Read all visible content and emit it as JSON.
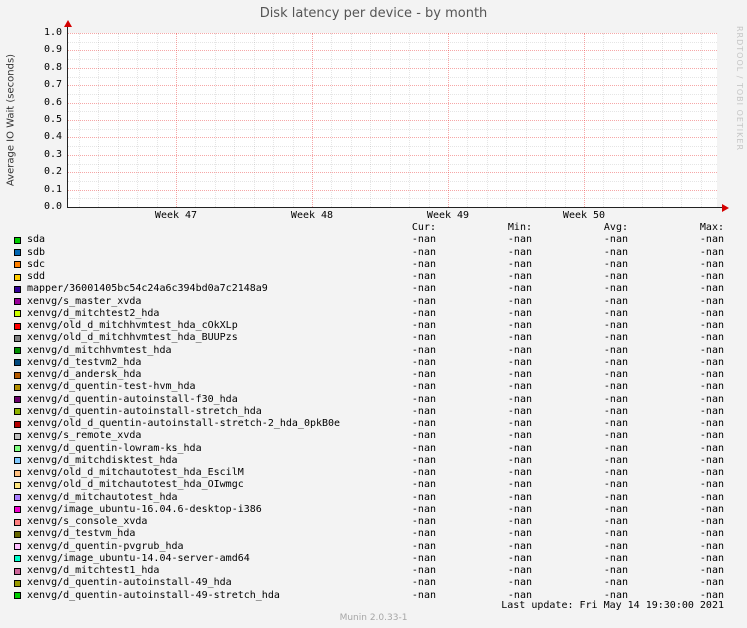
{
  "title": "Disk latency per device - by month",
  "watermark": "RRDTOOL / TOBI OETIKER",
  "y_axis": {
    "label": "Average IO Wait (seconds)"
  },
  "legend": {
    "headers": [
      "Cur:",
      "Min:",
      "Avg:",
      "Max:"
    ]
  },
  "footer": {
    "last_update": "Last update: Fri May 14 19:30:00 2021",
    "version": "Munin 2.0.33-1"
  },
  "chart_data": {
    "type": "line",
    "title": "Disk latency per device - by month",
    "xlabel": "",
    "ylabel": "Average IO Wait (seconds)",
    "ylim": [
      0.0,
      1.0
    ],
    "yticks": [
      0.0,
      0.1,
      0.2,
      0.3,
      0.4,
      0.5,
      0.6,
      0.7,
      0.8,
      0.9,
      1.0
    ],
    "xticklabels": [
      "Week 47",
      "Week 48",
      "Week 49",
      "Week 50"
    ],
    "grid": true,
    "legend_position": "bottom",
    "series": [
      {
        "name": "sda",
        "color": "#00CC00",
        "cur": "-nan",
        "min": "-nan",
        "avg": "-nan",
        "max": "-nan"
      },
      {
        "name": "sdb",
        "color": "#0066B3",
        "cur": "-nan",
        "min": "-nan",
        "avg": "-nan",
        "max": "-nan"
      },
      {
        "name": "sdc",
        "color": "#FF8000",
        "cur": "-nan",
        "min": "-nan",
        "avg": "-nan",
        "max": "-nan"
      },
      {
        "name": "sdd",
        "color": "#FFCC00",
        "cur": "-nan",
        "min": "-nan",
        "avg": "-nan",
        "max": "-nan"
      },
      {
        "name": "mapper/36001405bc54c24a6c394bd0a7c2148a9",
        "color": "#330099",
        "cur": "-nan",
        "min": "-nan",
        "avg": "-nan",
        "max": "-nan"
      },
      {
        "name": "xenvg/s_master_xvda",
        "color": "#990099",
        "cur": "-nan",
        "min": "-nan",
        "avg": "-nan",
        "max": "-nan"
      },
      {
        "name": "xenvg/d_mitchtest2_hda",
        "color": "#CCFF00",
        "cur": "-nan",
        "min": "-nan",
        "avg": "-nan",
        "max": "-nan"
      },
      {
        "name": "xenvg/old_d_mitchhvmtest_hda_cOkXLp",
        "color": "#FF0000",
        "cur": "-nan",
        "min": "-nan",
        "avg": "-nan",
        "max": "-nan"
      },
      {
        "name": "xenvg/old_d_mitchhvmtest_hda_BUUPzs",
        "color": "#808080",
        "cur": "-nan",
        "min": "-nan",
        "avg": "-nan",
        "max": "-nan"
      },
      {
        "name": "xenvg/d_mitchhvmtest_hda",
        "color": "#008F00",
        "cur": "-nan",
        "min": "-nan",
        "avg": "-nan",
        "max": "-nan"
      },
      {
        "name": "xenvg/d_testvm2_hda",
        "color": "#00487D",
        "cur": "-nan",
        "min": "-nan",
        "avg": "-nan",
        "max": "-nan"
      },
      {
        "name": "xenvg/d_andersk_hda",
        "color": "#B35A00",
        "cur": "-nan",
        "min": "-nan",
        "avg": "-nan",
        "max": "-nan"
      },
      {
        "name": "xenvg/d_quentin-test-hvm_hda",
        "color": "#B38F00",
        "cur": "-nan",
        "min": "-nan",
        "avg": "-nan",
        "max": "-nan"
      },
      {
        "name": "xenvg/d_quentin-autoinstall-f30_hda",
        "color": "#6B006B",
        "cur": "-nan",
        "min": "-nan",
        "avg": "-nan",
        "max": "-nan"
      },
      {
        "name": "xenvg/d_quentin-autoinstall-stretch_hda",
        "color": "#8FB300",
        "cur": "-nan",
        "min": "-nan",
        "avg": "-nan",
        "max": "-nan"
      },
      {
        "name": "xenvg/old_d_quentin-autoinstall-stretch-2_hda_0pkB0e",
        "color": "#B30000",
        "cur": "-nan",
        "min": "-nan",
        "avg": "-nan",
        "max": "-nan"
      },
      {
        "name": "xenvg/s_remote_xvda",
        "color": "#BEBEBE",
        "cur": "-nan",
        "min": "-nan",
        "avg": "-nan",
        "max": "-nan"
      },
      {
        "name": "xenvg/d_quentin-lowram-ks_hda",
        "color": "#80FF80",
        "cur": "-nan",
        "min": "-nan",
        "avg": "-nan",
        "max": "-nan"
      },
      {
        "name": "xenvg/d_mitchdisktest_hda",
        "color": "#80C9FF",
        "cur": "-nan",
        "min": "-nan",
        "avg": "-nan",
        "max": "-nan"
      },
      {
        "name": "xenvg/old_d_mitchautotest_hda_EscilM",
        "color": "#FFC080",
        "cur": "-nan",
        "min": "-nan",
        "avg": "-nan",
        "max": "-nan"
      },
      {
        "name": "xenvg/old_d_mitchautotest_hda_OIwmgc",
        "color": "#FFE680",
        "cur": "-nan",
        "min": "-nan",
        "avg": "-nan",
        "max": "-nan"
      },
      {
        "name": "xenvg/d_mitchautotest_hda",
        "color": "#AA80FF",
        "cur": "-nan",
        "min": "-nan",
        "avg": "-nan",
        "max": "-nan"
      },
      {
        "name": "xenvg/image_ubuntu-16.04.6-desktop-i386",
        "color": "#EE00CC",
        "cur": "-nan",
        "min": "-nan",
        "avg": "-nan",
        "max": "-nan"
      },
      {
        "name": "xenvg/s_console_xvda",
        "color": "#FF8080",
        "cur": "-nan",
        "min": "-nan",
        "avg": "-nan",
        "max": "-nan"
      },
      {
        "name": "xenvg/d_testvm_hda",
        "color": "#666600",
        "cur": "-nan",
        "min": "-nan",
        "avg": "-nan",
        "max": "-nan"
      },
      {
        "name": "xenvg/d_quentin-pvgrub_hda",
        "color": "#FFBFFF",
        "cur": "-nan",
        "min": "-nan",
        "avg": "-nan",
        "max": "-nan"
      },
      {
        "name": "xenvg/image_ubuntu-14.04-server-amd64",
        "color": "#00FFCC",
        "cur": "-nan",
        "min": "-nan",
        "avg": "-nan",
        "max": "-nan"
      },
      {
        "name": "xenvg/d_mitchtest1_hda",
        "color": "#CC6699",
        "cur": "-nan",
        "min": "-nan",
        "avg": "-nan",
        "max": "-nan"
      },
      {
        "name": "xenvg/d_quentin-autoinstall-49_hda",
        "color": "#999900",
        "cur": "-nan",
        "min": "-nan",
        "avg": "-nan",
        "max": "-nan"
      },
      {
        "name": "xenvg/d_quentin-autoinstall-49-stretch_hda",
        "color": "#00CC00",
        "cur": "-nan",
        "min": "-nan",
        "avg": "-nan",
        "max": "-nan"
      }
    ]
  }
}
